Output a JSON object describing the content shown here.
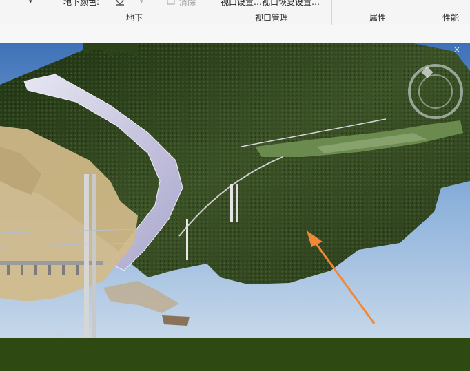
{
  "ribbon": {
    "underground": {
      "color_label": "地下颜色:",
      "clear_label": "清除",
      "group_label": "地下"
    },
    "viewport_group": {
      "label": "视口管理",
      "truncated_text": "视口设置…视口恢复设置…"
    },
    "properties_group": {
      "label": "属性"
    },
    "performance_group": {
      "label": "性能"
    }
  },
  "viewport": {
    "close_glyph": "×",
    "colors": {
      "sky_top": "#3e72b8",
      "sky_bottom": "#c7d8ea",
      "ground": "#2e4a12",
      "vegetation": "#3b5126",
      "road": "#c9c7df",
      "annotation_arrow": "#f08838"
    }
  }
}
